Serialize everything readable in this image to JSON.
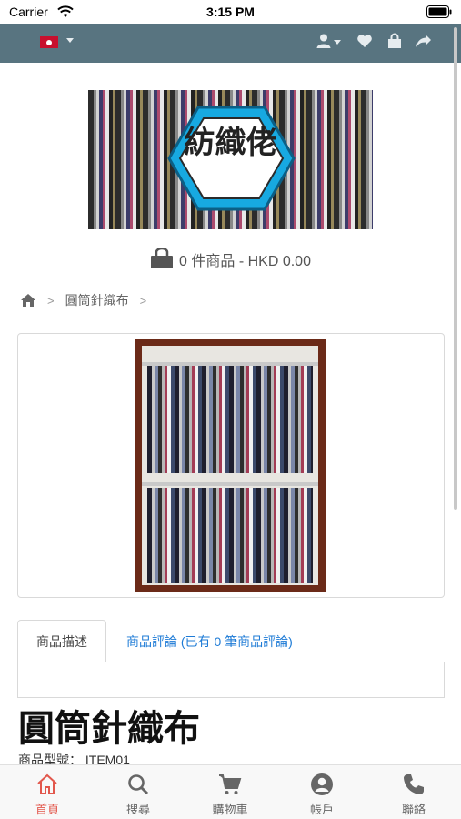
{
  "status_bar": {
    "carrier": "Carrier",
    "time": "3:15 PM"
  },
  "header": {
    "flag_icon": "hong-kong-flag-icon",
    "icons": [
      "user-icon",
      "heart-icon",
      "bag-icon",
      "share-icon"
    ]
  },
  "logo": {
    "text": "紡織佬"
  },
  "cart": {
    "summary": "0 件商品 - HKD 0.00"
  },
  "breadcrumb": {
    "home_icon": "home-icon",
    "current": "圓筒針織布"
  },
  "tabs": {
    "description": "商品描述",
    "reviews": "商品評論 (已有 0 筆商品評論)"
  },
  "product": {
    "title": "圓筒針織布",
    "model_label": "商品型號：",
    "model_value": "ITEM01"
  },
  "bottom_nav": {
    "items": [
      {
        "label": "首頁",
        "icon": "home-icon",
        "active": true
      },
      {
        "label": "搜尋",
        "icon": "search-icon"
      },
      {
        "label": "購物車",
        "icon": "cart-icon"
      },
      {
        "label": "帳戶",
        "icon": "account-icon"
      },
      {
        "label": "聯絡",
        "icon": "phone-icon"
      }
    ]
  },
  "colors": {
    "topbar": "#587480",
    "active_nav": "#e2574c",
    "link": "#1e7bd6"
  }
}
